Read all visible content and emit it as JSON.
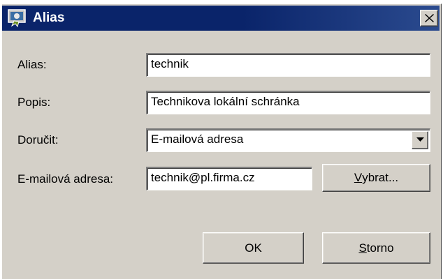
{
  "window": {
    "title": "Alias",
    "icon": "alias-app-icon"
  },
  "form": {
    "alias_label": "Alias:",
    "alias_value": "technik",
    "popis_label": "Popis:",
    "popis_value": "Technikova lokální schránka",
    "dorucit_label": "Doručit:",
    "dorucit_selected": "E-mailová adresa",
    "email_label": "E-mailová adresa:",
    "email_value": "technik@pl.firma.cz"
  },
  "buttons": {
    "vybrat_mnemonic": "V",
    "vybrat_rest": "ybrat...",
    "ok_label": "OK",
    "storno_mnemonic": "S",
    "storno_rest": "torno"
  },
  "colors": {
    "titlebar": "#0a246a",
    "dialog_bg": "#d4d0c8"
  }
}
